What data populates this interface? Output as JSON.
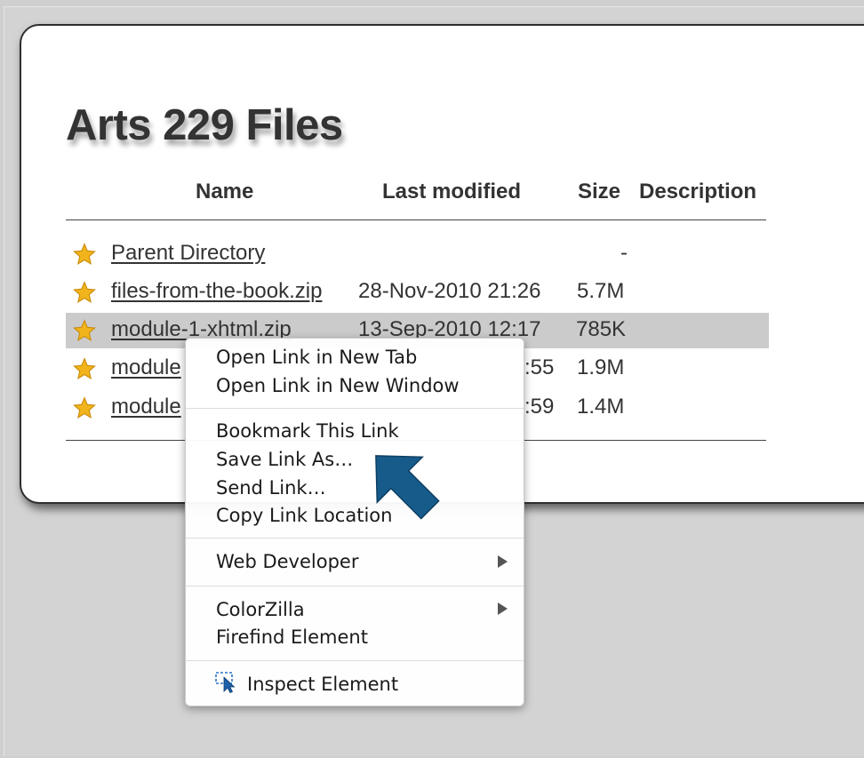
{
  "page": {
    "title": "Arts 229 Files"
  },
  "columns": {
    "name": "Name",
    "last_modified": "Last modified",
    "size": "Size",
    "description": "Description"
  },
  "rows": [
    {
      "name": "Parent Directory",
      "modified": "",
      "size": "-"
    },
    {
      "name": "files-from-the-book.zip",
      "modified": "28-Nov-2010 21:26",
      "size": "5.7M"
    },
    {
      "name": "module-1-xhtml.zip",
      "modified": "13-Sep-2010 12:17",
      "size": "785K"
    },
    {
      "name": "module",
      "modified": ":55",
      "size": "1.9M"
    },
    {
      "name": "module",
      "modified": ":59",
      "size": "1.4M"
    }
  ],
  "context_menu": {
    "open_new_tab": "Open Link in New Tab",
    "open_new_window": "Open Link in New Window",
    "bookmark": "Bookmark This Link",
    "save_as": "Save Link As…",
    "send_link": "Send Link…",
    "copy_location": "Copy Link Location",
    "web_developer": "Web Developer",
    "colorzilla": "ColorZilla",
    "firefind": "Firefind Element",
    "inspect": "Inspect Element"
  },
  "colors": {
    "highlight_row": "#cbcbcb",
    "pointer_arrow": "#175b8a",
    "star": "#f2b41c"
  }
}
